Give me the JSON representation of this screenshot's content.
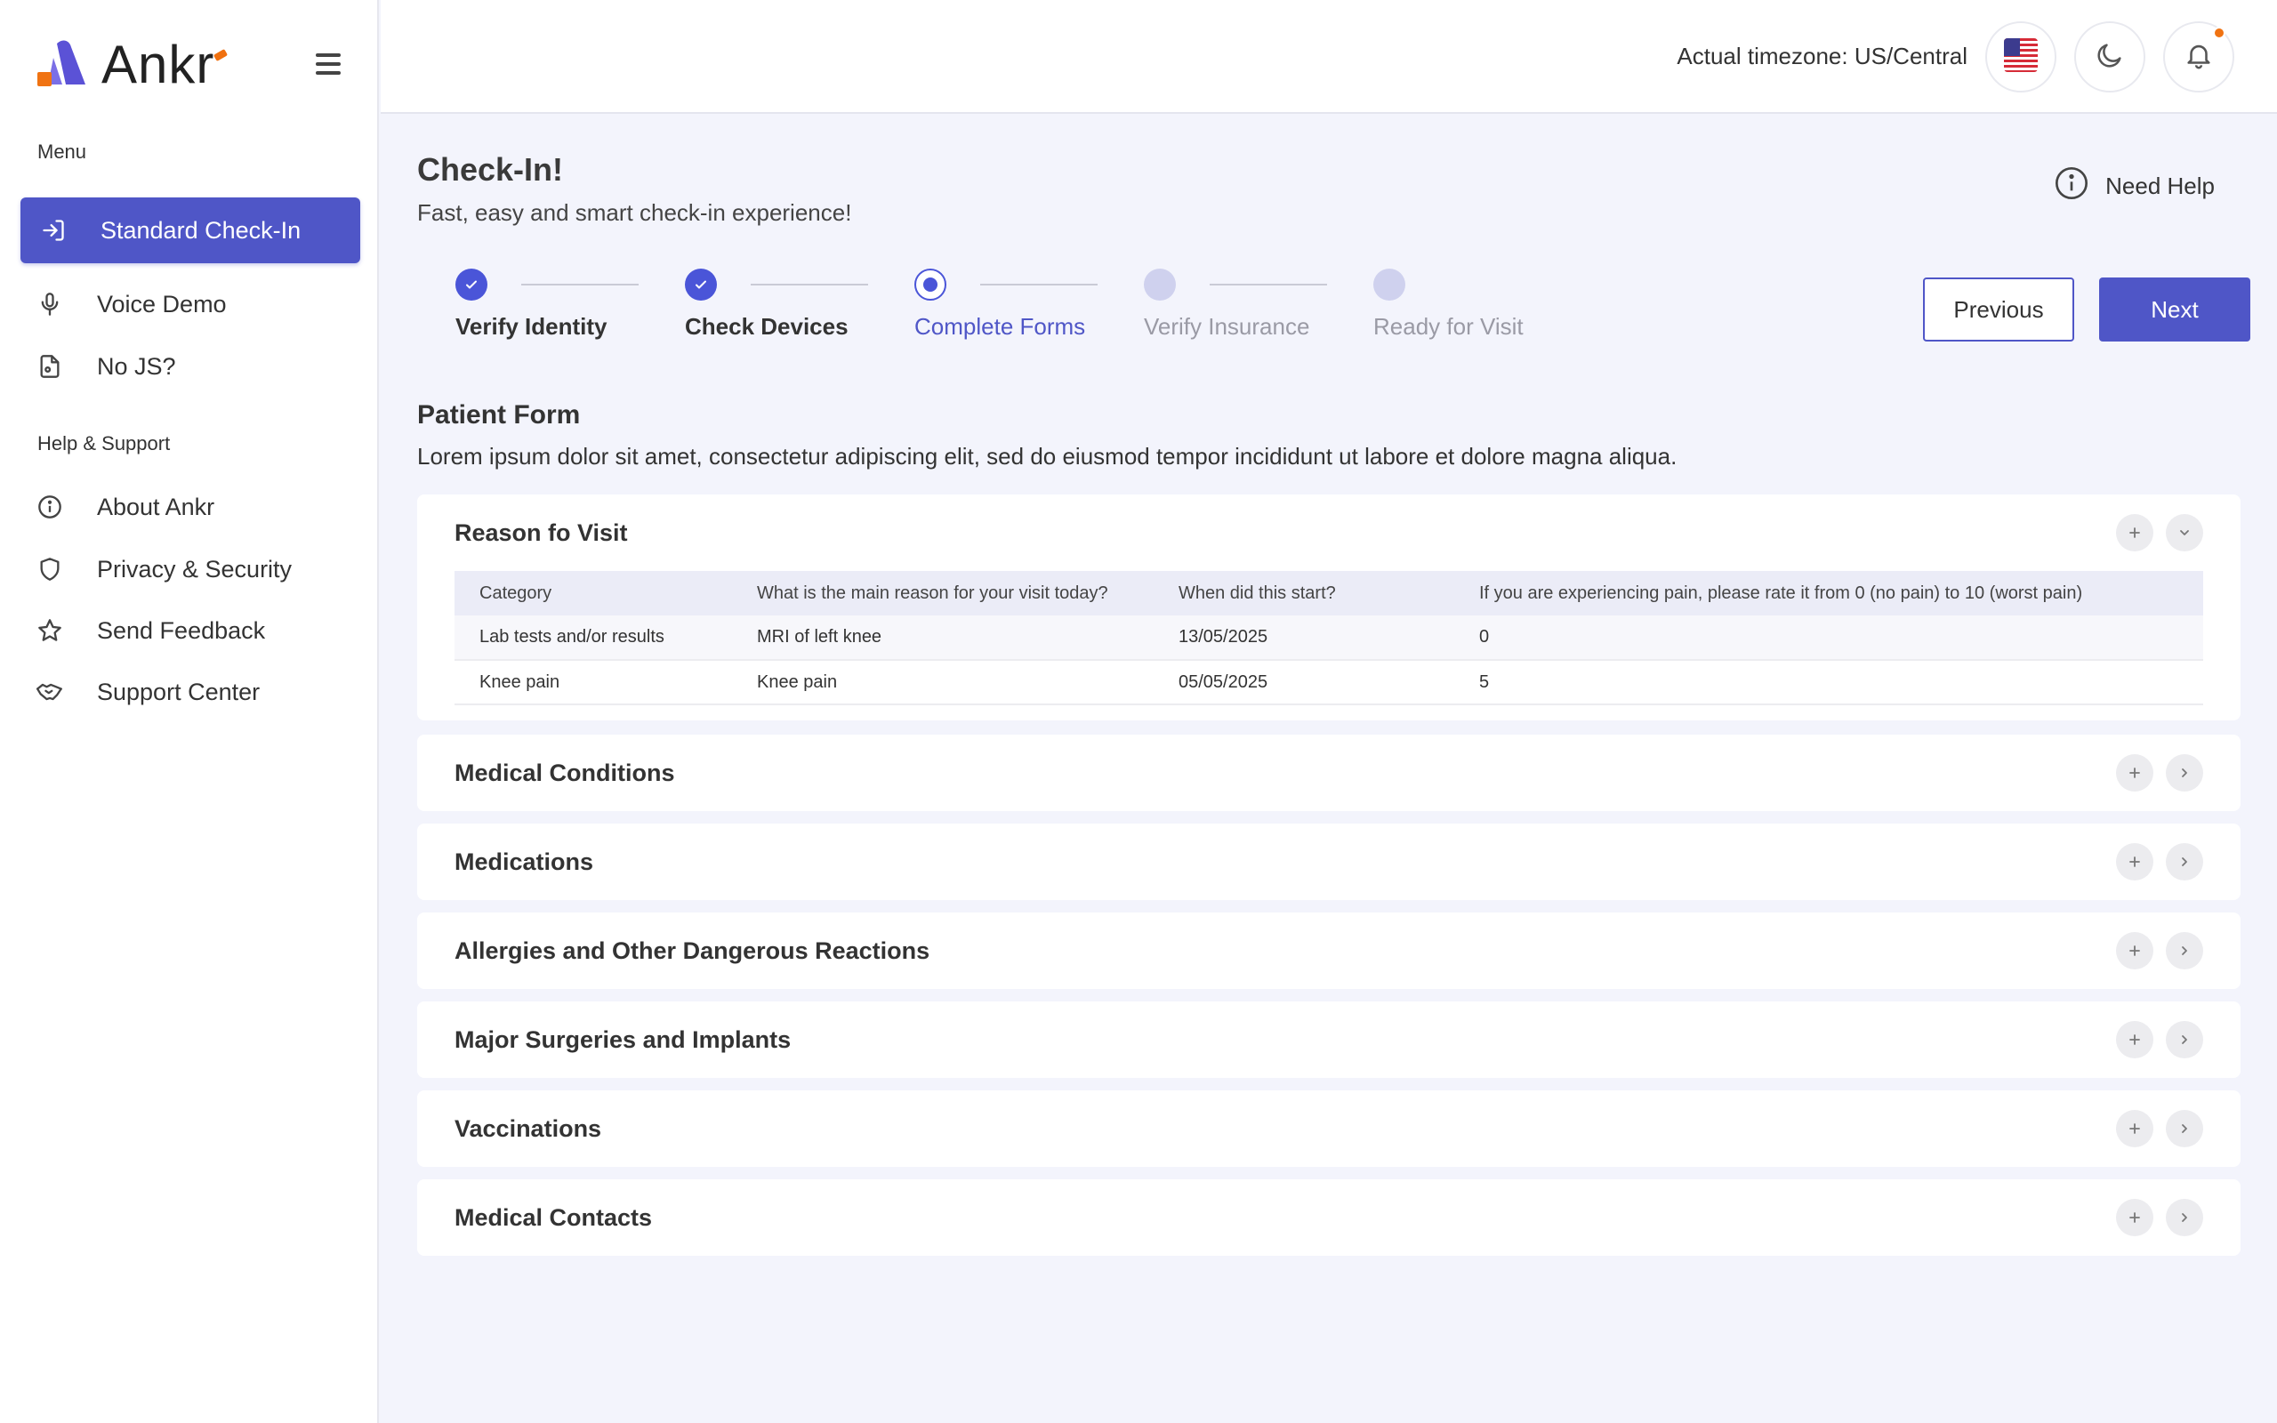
{
  "brand": {
    "name": "Ankr"
  },
  "sidebar": {
    "menu_label": "Menu",
    "menu_items": [
      {
        "label": "Standard Check-In",
        "icon": "sign-in-icon",
        "active": true
      },
      {
        "label": "Voice Demo",
        "icon": "microphone-icon"
      },
      {
        "label": "No JS?",
        "icon": "file-icon"
      }
    ],
    "help_label": "Help & Support",
    "help_items": [
      {
        "label": "About Ankr",
        "icon": "info-icon"
      },
      {
        "label": "Privacy & Security",
        "icon": "shield-icon"
      },
      {
        "label": "Send Feedback",
        "icon": "star-icon"
      },
      {
        "label": "Support Center",
        "icon": "handshake-icon"
      }
    ]
  },
  "header": {
    "timezone": "Actual timezone: US/Central",
    "icons": [
      "us-flag-icon",
      "moon-icon",
      "bell-icon"
    ]
  },
  "page": {
    "title": "Check-In!",
    "subtitle": "Fast, easy and smart check-in experience!",
    "need_help": "Need Help"
  },
  "steps": [
    {
      "label": "Verify Identity",
      "state": "done"
    },
    {
      "label": "Check Devices",
      "state": "done"
    },
    {
      "label": "Complete Forms",
      "state": "current"
    },
    {
      "label": "Verify Insurance",
      "state": "todo"
    },
    {
      "label": "Ready for Visit",
      "state": "todo"
    }
  ],
  "actions": {
    "previous": "Previous",
    "next": "Next"
  },
  "form": {
    "title": "Patient Form",
    "description": "Lorem ipsum dolor sit amet, consectetur adipiscing elit, sed do eiusmod tempor incididunt ut labore et dolore magna aliqua."
  },
  "reason": {
    "title": "Reason fo Visit",
    "columns": [
      "Category",
      "What is the main reason for your visit today?",
      "When did this start?",
      "If you are experiencing pain, please rate it from 0 (no pain) to 10 (worst pain)"
    ],
    "rows": [
      [
        "Lab tests and/or results",
        "MRI of left knee",
        "13/05/2025",
        "0"
      ],
      [
        "Knee pain",
        "Knee pain",
        "05/05/2025",
        "5"
      ]
    ]
  },
  "sections": [
    {
      "title": "Medical Conditions"
    },
    {
      "title": "Medications"
    },
    {
      "title": "Allergies and Other Dangerous Reactions"
    },
    {
      "title": "Major Surgeries and Implants"
    },
    {
      "title": "Vaccinations"
    },
    {
      "title": "Medical Contacts"
    }
  ],
  "colors": {
    "accent": "#4f56c7",
    "notification": "#f07312",
    "background": "#f3f4fc"
  }
}
